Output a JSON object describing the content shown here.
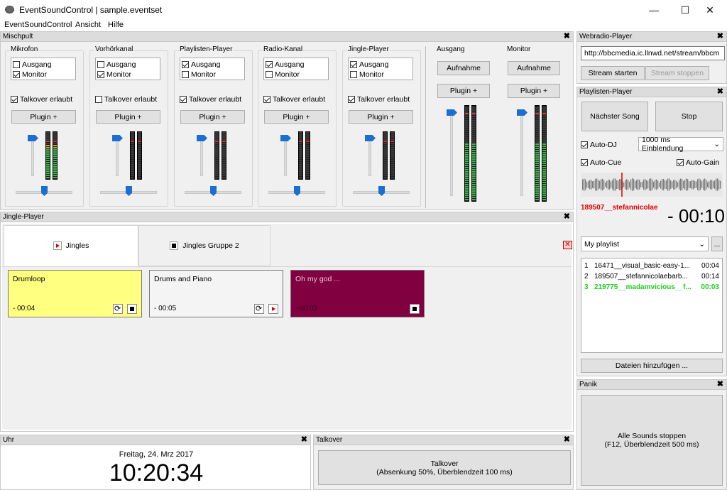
{
  "window": {
    "title": "EventSoundControl | sample.eventset",
    "minimize": "—",
    "maximize": "☐",
    "close": "✕"
  },
  "menu": [
    "EventSoundControl",
    "Ansicht",
    "Hilfe"
  ],
  "mixer": {
    "title": "Mischpult",
    "close": "✖",
    "channels": [
      {
        "name": "Mikrofon",
        "opt1": "Ausgang",
        "opt1_checked": false,
        "opt2": "Monitor",
        "opt2_checked": true,
        "talkover": "Talkover erlaubt",
        "talkover_checked": true,
        "plugin": "Plugin +"
      },
      {
        "name": "Vorhörkanal",
        "opt1": "Ausgang",
        "opt1_checked": false,
        "opt2": "Monitor",
        "opt2_checked": true,
        "talkover": "Talkover erlaubt",
        "talkover_checked": false,
        "plugin": "Plugin +"
      },
      {
        "name": "Playlisten-Player",
        "opt1": "Ausgang",
        "opt1_checked": true,
        "opt2": "Monitor",
        "opt2_checked": false,
        "talkover": "Talkover erlaubt",
        "talkover_checked": true,
        "plugin": "Plugin +"
      },
      {
        "name": "Radio-Kanal",
        "opt1": "Ausgang",
        "opt1_checked": true,
        "opt2": "Monitor",
        "opt2_checked": false,
        "talkover": "Talkover erlaubt",
        "talkover_checked": true,
        "plugin": "Plugin +"
      },
      {
        "name": "Jingle-Player",
        "opt1": "Ausgang",
        "opt1_checked": true,
        "opt2": "Monitor",
        "opt2_checked": false,
        "talkover": "Talkover erlaubt",
        "talkover_checked": true,
        "plugin": "Plugin +"
      }
    ],
    "outputs": [
      {
        "name": "Ausgang",
        "record": "Aufnahme",
        "plugin": "Plugin +"
      },
      {
        "name": "Monitor",
        "record": "Aufnahme",
        "plugin": "Plugin +"
      }
    ]
  },
  "jingle_player": {
    "title": "Jingle-Player",
    "close": "✖",
    "tabs": [
      "Jingles",
      "Jingles Gruppe 2"
    ],
    "remove_tab_icon": "remove-tab-icon",
    "cards": [
      {
        "title": "Drumloop",
        "time": "- 00:04",
        "color": "#ffff80"
      },
      {
        "title": "Drums and Piano",
        "time": "- 00:05",
        "color": "#f4f4f4",
        "title_color": "#1d9a1d"
      },
      {
        "title": "Oh my god ...",
        "time": "- 00:03",
        "color": "#800040"
      }
    ]
  },
  "clock": {
    "title": "Uhr",
    "close": "✖",
    "date": "Freitag, 24. Mrz 2017",
    "time": "10:20:34"
  },
  "talkover": {
    "title": "Talkover",
    "close": "✖",
    "button_line1": "Talkover",
    "button_line2": "(Absenkung 50%, Überblendzeit 100 ms)"
  },
  "webradio": {
    "title": "Webradio-Player",
    "close": "✖",
    "url": "http://bbcmedia.ic.llnwd.net/stream/bbcm",
    "start": "Stream starten",
    "stop": "Stream stoppen"
  },
  "playlist_player": {
    "title": "Playlisten-Player",
    "close": "✖",
    "next": "Nächster Song",
    "stop": "Stop",
    "auto_dj": "Auto-DJ",
    "fade": "1000 ms Einblendung",
    "auto_cue": "Auto-Cue",
    "auto_gain": "Auto-Gain",
    "current_track": "189507__stefannicolae",
    "remaining": "- 00:10",
    "playlist_name": "My playlist",
    "more": "...",
    "items": [
      {
        "num": "1",
        "name": "16471__visual_basic-easy-1...",
        "dur": "00:04"
      },
      {
        "num": "2",
        "name": "189507__stefannicolaebarb...",
        "dur": "00:14"
      },
      {
        "num": "3",
        "name": "219775__madamvicious__f...",
        "dur": "00:03"
      }
    ],
    "add_files": "Dateien hinzufügen ..."
  },
  "panic": {
    "title": "Panik",
    "close": "✖",
    "line1": "Alle Sounds stoppen",
    "line2": "(F12, Überblendzeit 500 ms)"
  },
  "colors": {
    "accent": "#1b6fd0",
    "active_track": "#22cc22",
    "current_track": "#e00000"
  }
}
